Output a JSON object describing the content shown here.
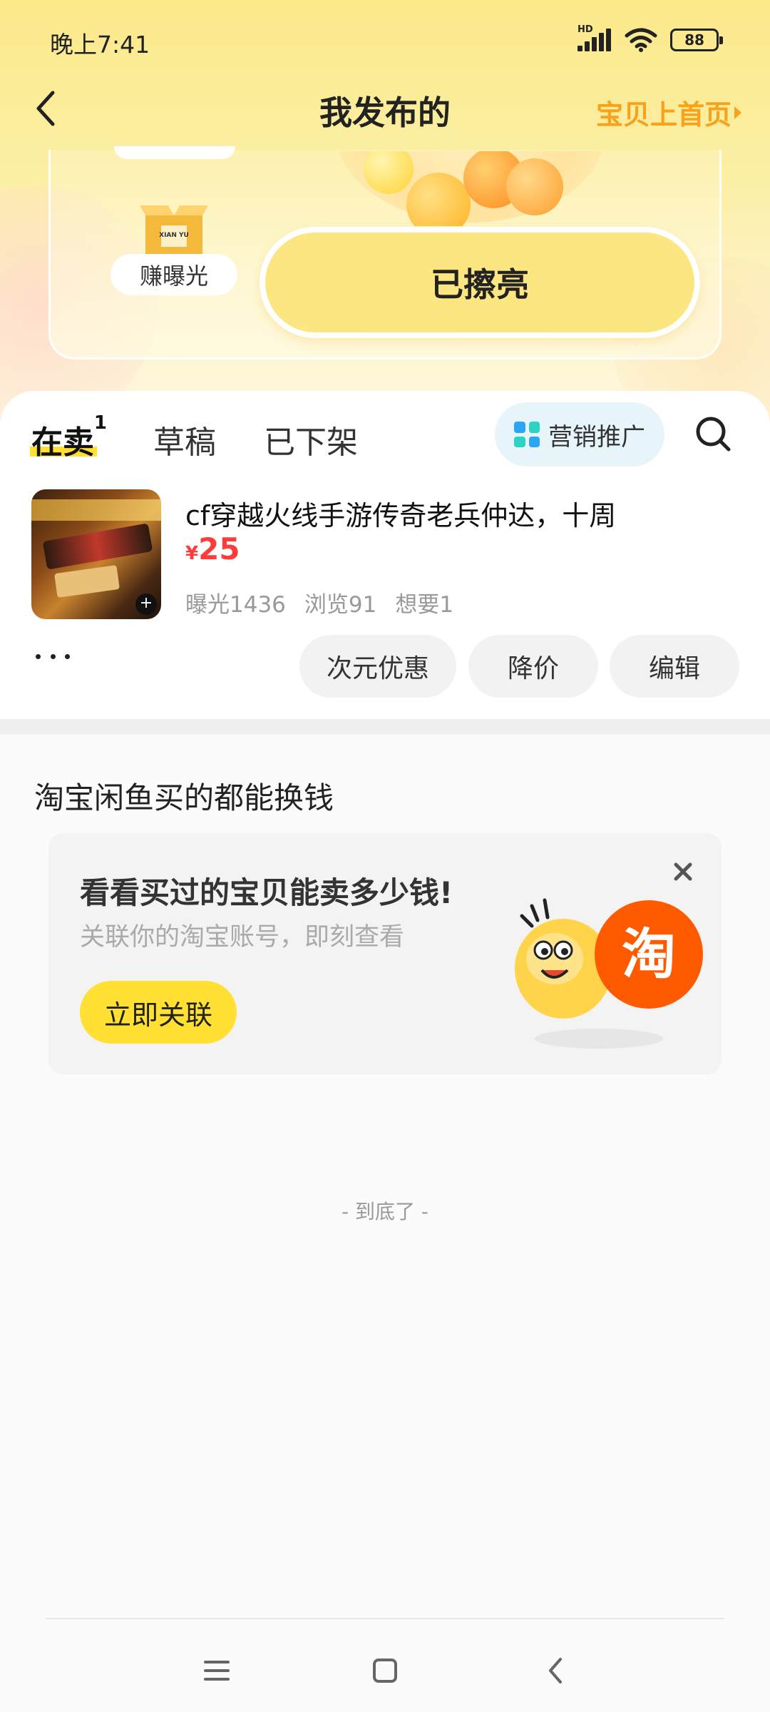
{
  "status_bar": {
    "time": "晚上7:41",
    "network_label": "HD",
    "battery": "88"
  },
  "nav": {
    "title": "我发布的",
    "right_link": "宝贝上首页"
  },
  "promo": {
    "box_label": "XIAN YU",
    "exposure_chip": "赚曝光",
    "polished_button": "已擦亮"
  },
  "tabs": {
    "on_sale": "在卖",
    "on_sale_count": "1",
    "drafts": "草稿",
    "removed": "已下架",
    "marketing": "营销推广"
  },
  "item": {
    "title": "cf穿越火线手游传奇老兵仲达，十周",
    "price_currency": "¥",
    "price": "25",
    "stats": {
      "exposure": "曝光1436",
      "views": "浏览91",
      "wants": "想要1"
    },
    "actions": {
      "discount": "次元优惠",
      "reduce_price": "降价",
      "edit": "编辑"
    }
  },
  "taobao": {
    "section_title": "淘宝闲鱼买的都能换钱",
    "headline": "看看买过的宝贝能卖多少钱!",
    "subtitle": "关联你的淘宝账号，即刻查看",
    "link_button": "立即关联",
    "badge_char": "淘"
  },
  "footer": {
    "end_text": "- 到底了 -"
  },
  "colors": {
    "accent_yellow": "#ffe033",
    "price_red": "#ff3b3b",
    "nav_link_orange": "#f7a21a",
    "taobao_orange": "#ff5a00"
  },
  "icons": [
    "back-icon",
    "search-icon",
    "grid-icon",
    "more-icon",
    "close-icon",
    "box-icon",
    "menu-icon",
    "home-icon",
    "back-nav-icon"
  ]
}
